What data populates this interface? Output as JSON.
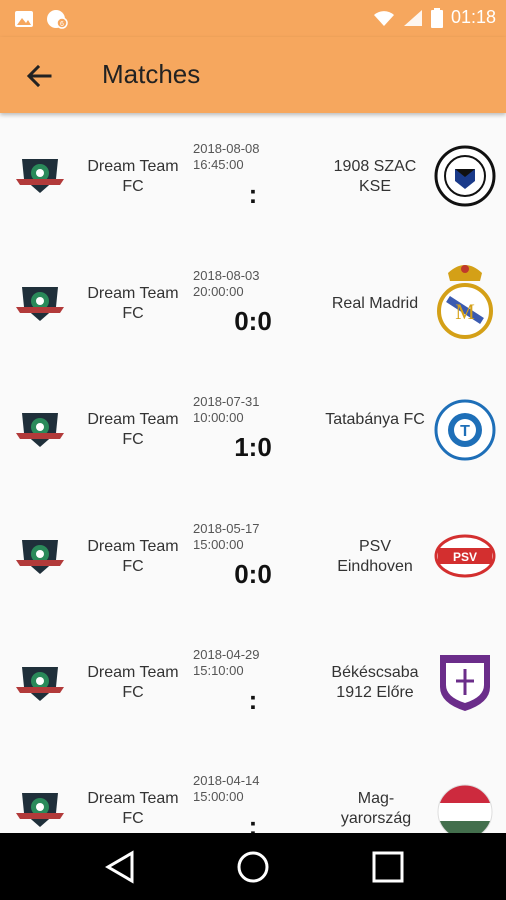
{
  "status": {
    "time": "01:18",
    "notif_badge": "6"
  },
  "header": {
    "title": "Matches"
  },
  "matches": [
    {
      "home": "Dream Team FC",
      "date": "2018-08-08",
      "time": "16:45:00",
      "score": ":",
      "away": "1908 SZAC KSE",
      "away_logo": "szac-logo-icon"
    },
    {
      "home": "Dream Team FC",
      "date": "2018-08-03",
      "time": "20:00:00",
      "score": "0:0",
      "away": "Real Madrid",
      "away_logo": "real-madrid-logo-icon"
    },
    {
      "home": "Dream Team FC",
      "date": "2018-07-31",
      "time": "10:00:00",
      "score": "1:0",
      "away": "Tatabánya FC",
      "away_logo": "tatabanya-logo-icon"
    },
    {
      "home": "Dream Team FC",
      "date": "2018-05-17",
      "time": "15:00:00",
      "score": "0:0",
      "away": "PSV Eindhoven",
      "away_logo": "psv-logo-icon"
    },
    {
      "home": "Dream Team FC",
      "date": "2018-04-29",
      "time": "15:10:00",
      "score": ":",
      "away": "Békéscsaba 1912 Előre",
      "away_logo": "bekescsaba-logo-icon"
    },
    {
      "home": "Dream Team FC",
      "date": "2018-04-14",
      "time": "15:00:00",
      "score": ":",
      "away": "Mag-yarország",
      "away_logo": "hungary-flag-icon"
    }
  ],
  "colors": {
    "accent": "#f6a75e",
    "navbar": "#000000"
  }
}
